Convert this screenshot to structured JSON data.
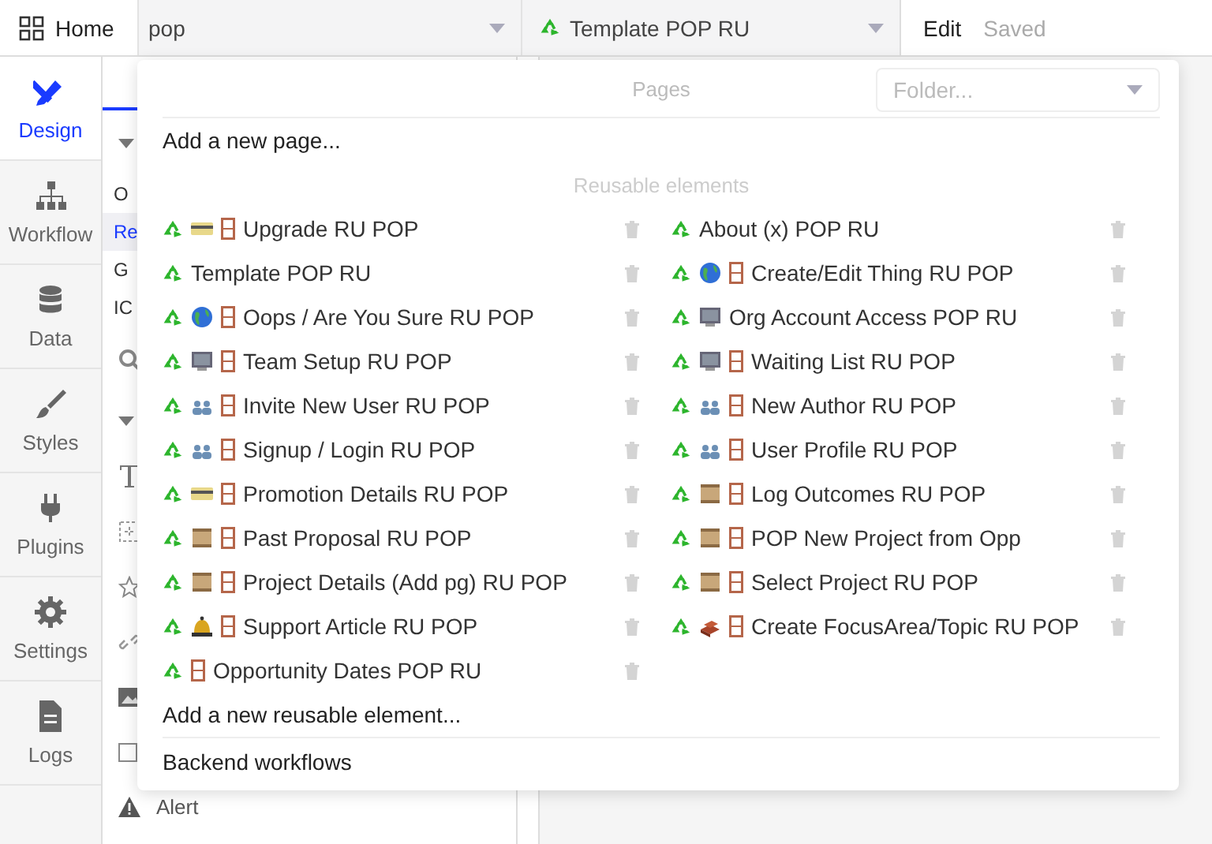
{
  "topbar": {
    "home": "Home",
    "page_select": {
      "value": "pop"
    },
    "element_select": {
      "value": "Template POP RU"
    },
    "edit": "Edit",
    "status": "Saved"
  },
  "sidebar": [
    {
      "label": "Design",
      "selected": true
    },
    {
      "label": "Workflow",
      "selected": false
    },
    {
      "label": "Data",
      "selected": false
    },
    {
      "label": "Styles",
      "selected": false
    },
    {
      "label": "Plugins",
      "selected": false
    },
    {
      "label": "Settings",
      "selected": false
    },
    {
      "label": "Logs",
      "selected": false
    }
  ],
  "tree_items": [
    {
      "text": "O",
      "selected": false
    },
    {
      "text": "Re",
      "selected": true
    },
    {
      "text": "G",
      "selected": false
    },
    {
      "text": "IC",
      "selected": false
    }
  ],
  "palette_label": "Alert",
  "menu": {
    "pages_heading": "Pages",
    "folder": {
      "placeholder": "Folder..."
    },
    "add_page": "Add a new page...",
    "reusable_heading": "Reusable elements",
    "columns": [
      [
        {
          "name": "Upgrade RU POP",
          "kind": "card",
          "door": true
        },
        {
          "name": "Template POP RU",
          "kind": "plain",
          "door": false
        },
        {
          "name": "Oops / Are You Sure RU POP",
          "kind": "globe",
          "door": true
        },
        {
          "name": "Team Setup RU POP",
          "kind": "monitor",
          "door": true
        },
        {
          "name": "Invite New User RU POP",
          "kind": "people",
          "door": true
        },
        {
          "name": "Signup / Login RU POP",
          "kind": "people",
          "door": true
        },
        {
          "name": "Promotion Details RU POP",
          "kind": "card",
          "door": true
        },
        {
          "name": "Past Proposal RU POP",
          "kind": "scroll",
          "door": true
        },
        {
          "name": "Project Details (Add pg) RU POP",
          "kind": "scroll",
          "door": true
        },
        {
          "name": "Support Article RU POP",
          "kind": "bell",
          "door": true
        },
        {
          "name": "Opportunity Dates POP RU",
          "kind": "plain",
          "door": true
        }
      ],
      [
        {
          "name": "About (x) POP RU",
          "kind": "plain",
          "door": false
        },
        {
          "name": "Create/Edit Thing RU POP",
          "kind": "globe",
          "door": true
        },
        {
          "name": "Org Account Access POP RU",
          "kind": "monitor",
          "door": false
        },
        {
          "name": "Waiting List RU POP",
          "kind": "monitor",
          "door": true
        },
        {
          "name": "New Author RU POP",
          "kind": "people",
          "door": true
        },
        {
          "name": "User Profile RU POP",
          "kind": "people",
          "door": true
        },
        {
          "name": "Log Outcomes RU POP",
          "kind": "scroll",
          "door": true
        },
        {
          "name": "POP New Project from Opp",
          "kind": "scroll",
          "door": true
        },
        {
          "name": "Select Project RU POP",
          "kind": "scroll",
          "door": true
        },
        {
          "name": "Create FocusArea/Topic RU POP",
          "kind": "bricks",
          "door": true
        }
      ]
    ],
    "add_reusable": "Add a new reusable element...",
    "backend": "Backend workflows"
  }
}
